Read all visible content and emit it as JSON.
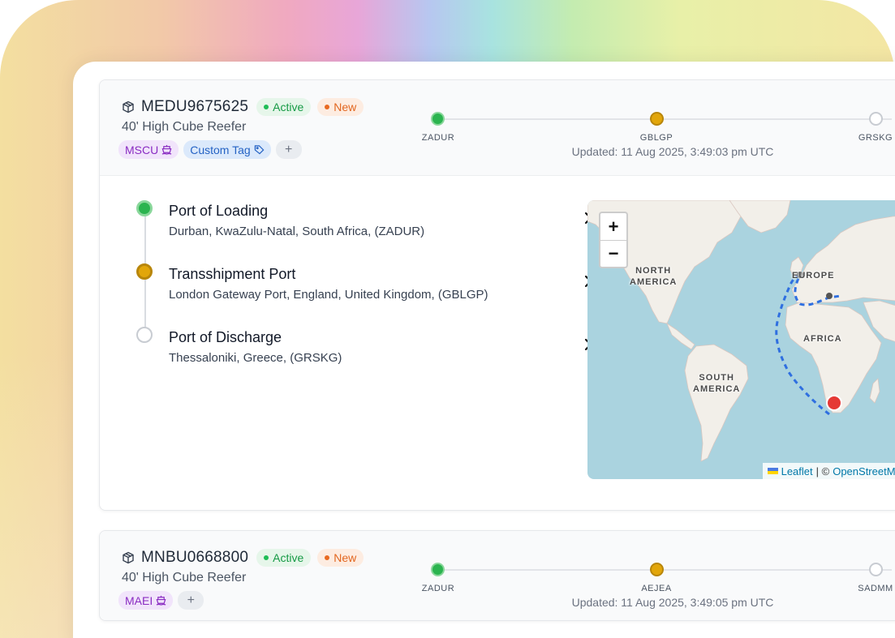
{
  "shipments": [
    {
      "container_id": "MEDU9675625",
      "status_active": "Active",
      "status_new": "New",
      "container_type": "40' High Cube Reefer",
      "carrier_tag": "MSCU",
      "custom_tag": "Custom Tag",
      "add_tag": "+",
      "route": [
        "ZADUR",
        "GBLGP",
        "GRSKG"
      ],
      "updated": "Updated: 11 Aug 2025, 3:49:03 pm UTC",
      "stops": [
        {
          "title": "Port of Loading",
          "location": "Durban, KwaZulu-Natal, South Africa, (ZADUR)"
        },
        {
          "title": "Transshipment Port",
          "location": "London Gateway Port, England, United Kingdom, (GBLGP)"
        },
        {
          "title": "Port of Discharge",
          "location": "Thessaloniki, Greece, (GRSKG)"
        }
      ],
      "map": {
        "zoom_in": "+",
        "zoom_out": "−",
        "labels": {
          "north_america": "NORTH\nAMERICA",
          "europe": "EUROPE",
          "africa": "AFRICA",
          "south_america": "SOUTH\nAMERICA"
        },
        "attribution_leaflet": "Leaflet",
        "attribution_sep": "| ©",
        "attribution_osm": "OpenStreetMap"
      }
    },
    {
      "container_id": "MNBU0668800",
      "status_active": "Active",
      "status_new": "New",
      "container_type": "40' High Cube Reefer",
      "carrier_tag": "MAEI",
      "add_tag": "+",
      "route": [
        "ZADUR",
        "AEJEA",
        "SADMM"
      ],
      "updated": "Updated: 11 Aug 2025, 3:49:05 pm UTC"
    }
  ],
  "colors": {
    "green": "#2bb44f",
    "amber": "#e2a60a",
    "route_dash": "#2f6fe0",
    "destination_marker": "#e53935"
  }
}
